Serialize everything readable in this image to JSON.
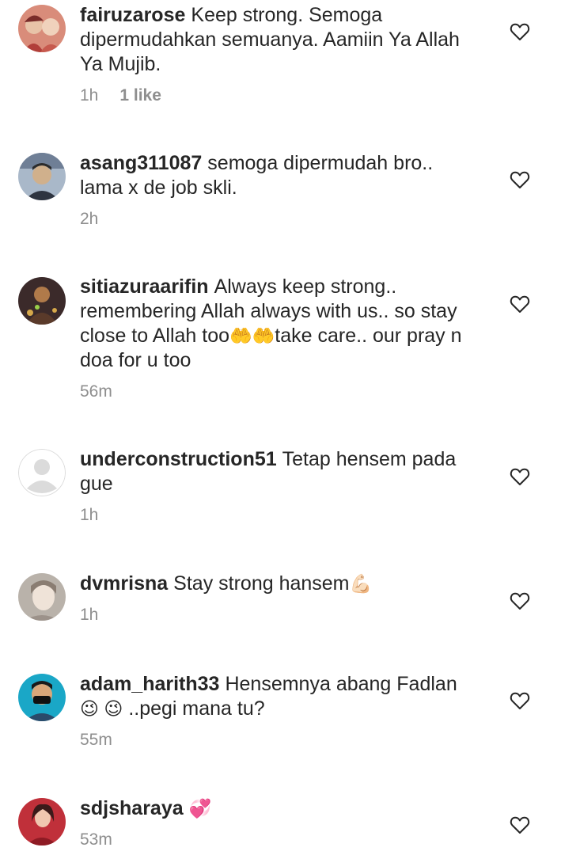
{
  "comments": [
    {
      "username": "fairuzarose",
      "text": "Keep strong. Semoga dipermudahkan semuanya. Aamiin Ya Allah Ya Mujib.",
      "time": "1h",
      "likes": "1 like",
      "avatar_colors": [
        "#c75a4e",
        "#e8c3a8"
      ]
    },
    {
      "username": "asang311087",
      "text": "semoga dipermudah bro.. lama x de job skli.",
      "time": "2h",
      "avatar_colors": [
        "#8aa0b8",
        "#d0b08c"
      ]
    },
    {
      "username": "sitiazuraarifin",
      "text": "Always keep strong.. remembering Allah always with us.. so stay close to Allah too",
      "emoji": "🤲🤲",
      "text_after": "take care.. our pray n doa for u too",
      "time": "56m",
      "avatar_colors": [
        "#3b2a2a",
        "#b07a4a"
      ]
    },
    {
      "username": "underconstruction51",
      "text": "Tetap hensem pada gue",
      "time": "1h",
      "avatar_colors": [
        "#dbdbdb",
        "#ffffff"
      ]
    },
    {
      "username": "dvmrisna",
      "text": "Stay strong hansem",
      "emoji": "💪🏻",
      "time": "1h",
      "avatar_colors": [
        "#b9b2aa",
        "#efe3d8"
      ]
    },
    {
      "username": "adam_harith33",
      "text": "Hensemnya abang Fadlan",
      "emoji": "😉 😉",
      "text_after": "..pegi mana tu?",
      "time": "55m",
      "avatar_colors": [
        "#1aa7c7",
        "#1a1a1a"
      ]
    },
    {
      "username": "sdjsharaya",
      "text": "",
      "emoji": "💞",
      "time": "53m",
      "avatar_colors": [
        "#c0303a",
        "#f0c7b0"
      ]
    }
  ],
  "icons": {
    "like": "heart-outline-icon",
    "avatar_placeholder": "user-silhouette-icon"
  },
  "colors": {
    "text": "#262626",
    "meta": "#8e8e8e",
    "heart": "#262626"
  }
}
